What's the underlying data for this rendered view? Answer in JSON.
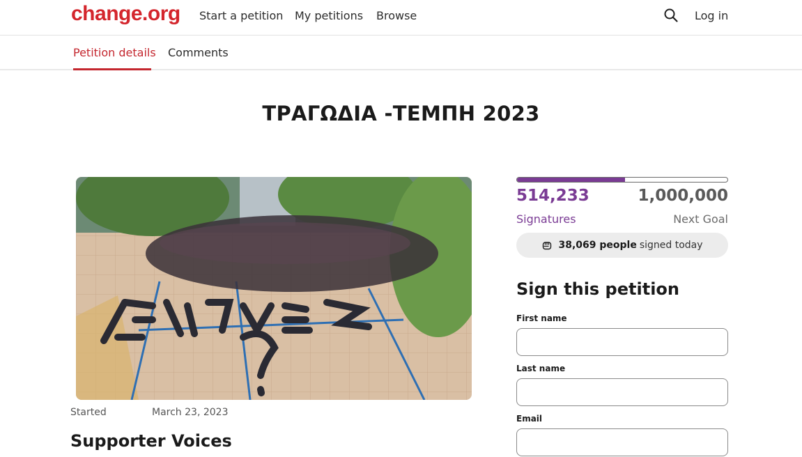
{
  "header": {
    "logo": "change.org",
    "nav": [
      "Start a petition",
      "My petitions",
      "Browse"
    ],
    "login": "Log in"
  },
  "tabs": [
    {
      "label": "Petition details",
      "active": true
    },
    {
      "label": "Comments",
      "active": false
    }
  ],
  "petition": {
    "title": "ΤΡΑΓΩΔΙΑ -ΤΕΜΠΗ 2023",
    "started_label": "Started",
    "started_date": "March 23, 2023",
    "supporter_voices": "Supporter Voices"
  },
  "signatures": {
    "count": "514,233",
    "count_label": "Signatures",
    "goal": "1,000,000",
    "goal_label": "Next Goal",
    "progress_fraction": 0.514,
    "today_count": "38,069 people",
    "today_suffix": "signed today"
  },
  "form": {
    "title": "Sign this petition",
    "first_name_label": "First name",
    "last_name_label": "Last name",
    "email_label": "Email"
  },
  "colors": {
    "brand_red": "#d4262d",
    "accent_purple": "#7a3b94"
  },
  "icons": {
    "search": "search-icon",
    "today": "fist-icon"
  }
}
